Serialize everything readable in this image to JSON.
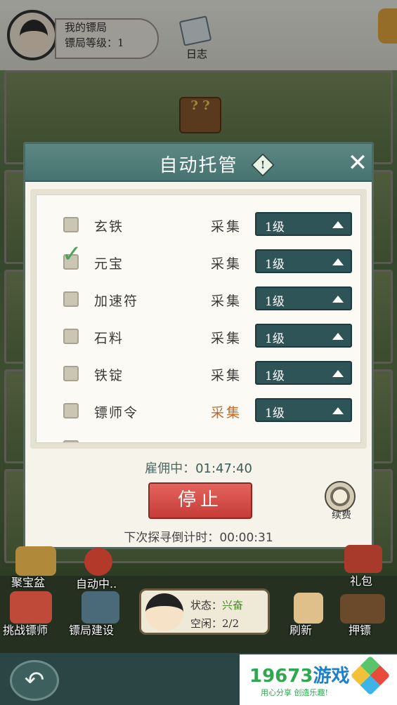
{
  "header": {
    "title": "我的镖局",
    "level": "镖局等级：1",
    "journal_label": "日志"
  },
  "dialog": {
    "title": "自动托管",
    "info_symbol": "!",
    "close_symbol": "✕",
    "items": [
      {
        "name": "玄铁",
        "action": "采集",
        "level": "1级",
        "checked": false
      },
      {
        "name": "元宝",
        "action": "采集",
        "level": "1级",
        "checked": true
      },
      {
        "name": "加速符",
        "action": "采集",
        "level": "1级",
        "checked": false
      },
      {
        "name": "石料",
        "action": "采集",
        "level": "1级",
        "checked": false
      },
      {
        "name": "铁锭",
        "action": "采集",
        "level": "1级",
        "checked": false
      },
      {
        "name": "镖师令",
        "action": "采集",
        "level": "1级",
        "checked": false
      }
    ],
    "hire_label": "雇佣中：",
    "hire_time": "01:47:40",
    "stop_label": "停止",
    "renew_label": "续费",
    "next_label": "下次探寻倒计时：",
    "next_time": "00:00:31",
    "check_symbol": "✓"
  },
  "bottom": {
    "treasure": "聚宝盆",
    "auto": "自动中..",
    "gift": "礼包",
    "challenge": "挑战镖师",
    "build": "镖局建设",
    "refresh": "刷新",
    "escort": "押镖",
    "status_label": "状态：",
    "status_value": "兴奋",
    "idle_label": "空闲：",
    "idle_value": "2/2"
  },
  "footer": {
    "back_symbol": "↶",
    "ad_brand_num": "19673",
    "ad_brand_txt": "游戏",
    "ad_slogan": "用心分享 创造乐趣!"
  },
  "colors": {
    "dialog_header": "#467370",
    "level_select": "#2f5458",
    "stop_button": "#c73c38",
    "checked": "#4aa35a",
    "highlight_action": "#c06a2a"
  }
}
